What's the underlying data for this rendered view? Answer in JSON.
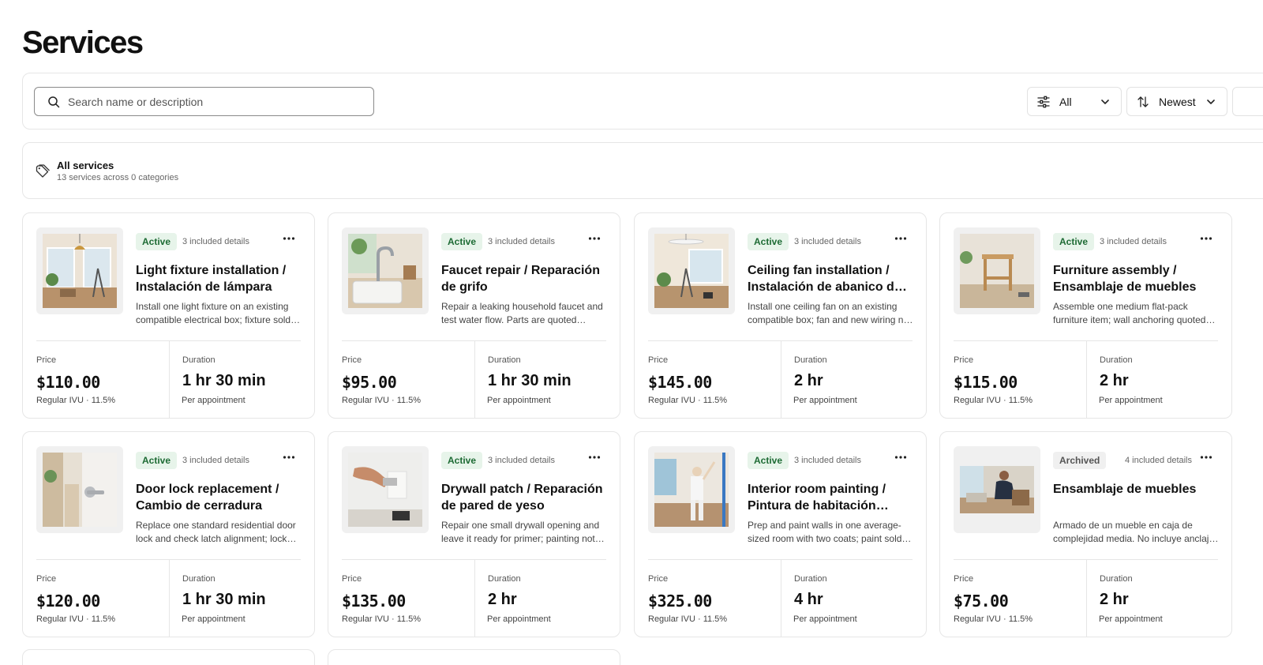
{
  "page": {
    "title": "Services"
  },
  "search": {
    "placeholder": "Search name or description"
  },
  "filters": {
    "status_label": "All",
    "sort_label": "Newest"
  },
  "category": {
    "title": "All services",
    "subtitle": "13 services across 0 categories"
  },
  "labels": {
    "price": "Price",
    "duration": "Duration",
    "tax": "Regular IVU · 11.5%",
    "per": "Per appointment"
  },
  "cards": [
    {
      "status": "Active",
      "details": "3 included details",
      "title": "Light fixture installation / Instalación de lámpara",
      "desc": "Install one light fixture on an existing compatible electrical box; fixture sold separately.",
      "price": "$110.00",
      "duration": "1 hr 30 min",
      "image": "room-lamp"
    },
    {
      "status": "Active",
      "details": "3 included details",
      "title": "Faucet repair / Reparación de grifo",
      "desc": "Repair a leaking household faucet and test water flow. Parts are quoted separately.",
      "price": "$95.00",
      "duration": "1 hr 30 min",
      "image": "kitchen-faucet"
    },
    {
      "status": "Active",
      "details": "3 included details",
      "title": "Ceiling fan installation / Instalación de abanico de techo",
      "desc": "Install one ceiling fan on an existing compatible box; fan and new wiring not included.",
      "price": "$145.00",
      "duration": "2 hr",
      "image": "room-fan"
    },
    {
      "status": "Active",
      "details": "3 included details",
      "title": "Furniture assembly / Ensamblaje de muebles",
      "desc": "Assemble one medium flat-pack furniture item; wall anchoring quoted separately.",
      "price": "$115.00",
      "duration": "2 hr",
      "image": "furniture"
    },
    {
      "status": "Active",
      "details": "3 included details",
      "title": "Door lock replacement / Cambio de cerradura",
      "desc": "Replace one standard residential door lock and check latch alignment; lock sold separately.",
      "price": "$120.00",
      "duration": "1 hr 30 min",
      "image": "door-lock"
    },
    {
      "status": "Active",
      "details": "3 included details",
      "title": "Drywall patch / Reparación de pared de yeso",
      "desc": "Repair one small drywall opening and leave it ready for primer; painting not included.",
      "price": "$135.00",
      "duration": "2 hr",
      "image": "drywall"
    },
    {
      "status": "Active",
      "details": "3 included details",
      "title": "Interior room painting / Pintura de habitación interior",
      "desc": "Prep and paint walls in one average-sized room with two coats; paint sold separately.",
      "price": "$325.00",
      "duration": "4 hr",
      "image": "painting"
    },
    {
      "status": "Archived",
      "details": "4 included details",
      "title": "Ensamblaje de muebles",
      "desc": "Armado de un mueble en caja de complejidad media. No incluye anclaje a la pared.",
      "price": "$75.00",
      "duration": "2 hr",
      "image": "assembly-person"
    }
  ]
}
